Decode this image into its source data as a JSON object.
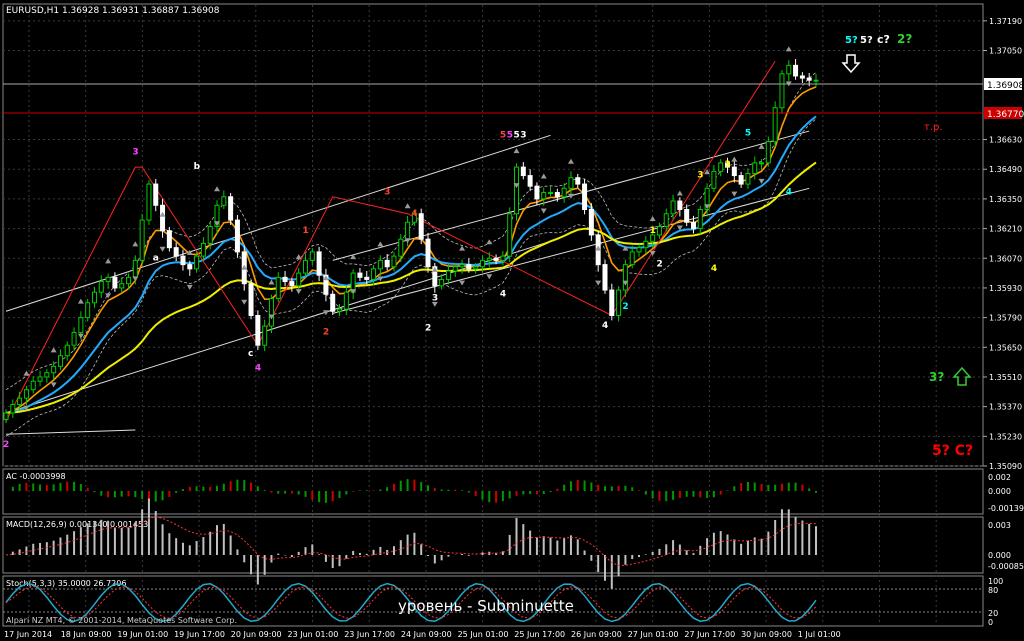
{
  "main_panel": {
    "header": "EURUSD,H1  1.36928 1.36931 1.36887 1.36908",
    "price_ticks": [
      "1.37190",
      "1.37050",
      "1.36630",
      "1.36490",
      "1.36350",
      "1.36210",
      "1.36070",
      "1.35930",
      "1.35790",
      "1.35650",
      "1.35510",
      "1.35370",
      "1.35230",
      "1.35090"
    ],
    "current_price_label": "1.36908",
    "tp_price_label": "1.36770",
    "tp_text": "т.р.",
    "chart_annotations": {
      "target_5": "5?",
      "target_5b": "5?",
      "target_c": "c?",
      "target_2": "2?",
      "lower_3": "3?",
      "bottom_5c": "5? C?"
    },
    "wave_labels": [
      {
        "text": "3",
        "color": "#ff44ff"
      },
      {
        "text": "b",
        "color": "#ffffff"
      },
      {
        "text": "a",
        "color": "#ffffff"
      },
      {
        "text": "c",
        "color": "#ffffff"
      },
      {
        "text": "4",
        "color": "#ff44ff"
      },
      {
        "text": "1",
        "color": "#ff4422"
      },
      {
        "text": "2",
        "color": "#ff4422"
      },
      {
        "text": "3",
        "color": "#ff4422"
      },
      {
        "text": "4",
        "color": "#ff4422"
      },
      {
        "text": "3",
        "color": "#ffffff"
      },
      {
        "text": "2",
        "color": "#ffffff"
      },
      {
        "text": "4",
        "color": "#ffffff"
      },
      {
        "text": "5",
        "color": "#ff4444"
      },
      {
        "text": "5",
        "color": "#ff44ff"
      },
      {
        "text": "5",
        "color": "#ffffff"
      },
      {
        "text": "3",
        "color": "#ffffff"
      },
      {
        "text": "4",
        "color": "#ffffff"
      },
      {
        "text": "2",
        "color": "#00ffff"
      },
      {
        "text": "1",
        "color": "#ffff00"
      },
      {
        "text": "2",
        "color": "#ffffff"
      },
      {
        "text": "3",
        "color": "#ffff00"
      },
      {
        "text": "4",
        "color": "#ffff00"
      },
      {
        "text": "3",
        "color": "#ffff00"
      },
      {
        "text": "5",
        "color": "#00ffff"
      },
      {
        "text": "4",
        "color": "#00ffff"
      },
      {
        "text": "2",
        "color": "#ff44ff"
      }
    ]
  },
  "ac_panel": {
    "header": "AC -0.0003998",
    "ticks": [
      "0.002",
      "0.000",
      "-0.001394"
    ]
  },
  "macd_panel": {
    "header": "MACD(12,26,9) 0.001340 0.001453",
    "ticks": [
      "0.003",
      "0.000",
      "-0.000854"
    ]
  },
  "stoch_panel": {
    "header": "Stoch(5,3,3) 35.0000 26.7206",
    "ticks": [
      "100",
      "80",
      "20",
      "0"
    ],
    "overlay_text": "уровень - Subminuette",
    "copyright": "Alpari NZ MT4, © 2001-2014, MetaQuotes Software Corp."
  },
  "time_axis": [
    "17 Jun 2014",
    "18 Jun 09:00",
    "19 Jun 01:00",
    "19 Jun 17:00",
    "20 Jun 09:00",
    "23 Jun 01:00",
    "23 Jun 17:00",
    "24 Jun 09:00",
    "25 Jun 01:00",
    "25 Jun 17:00",
    "26 Jun 09:00",
    "27 Jun 01:00",
    "27 Jun 17:00",
    "30 Jun 09:00",
    "1 Jul 01:00"
  ],
  "colors": {
    "background": "#000000",
    "bull_candle": "#00cc00",
    "bear_candle": "#ffffff",
    "grid": "#3a3a3a",
    "ma_fast": "#ff9900",
    "ma_mid": "#22aaff",
    "ma_slow": "#eeee00",
    "zigzag": "#ff2222",
    "tp_line": "#cc0000"
  },
  "chart_data": {
    "type": "candlestick",
    "symbol": "EURUSD",
    "timeframe": "H1",
    "ylim": [
      1.3509,
      1.3726
    ],
    "price_line": 1.36908,
    "tp_line": 1.3677,
    "close_series": [
      1.3534,
      1.3538,
      1.3541,
      1.3545,
      1.3549,
      1.3551,
      1.3553,
      1.3556,
      1.3561,
      1.3566,
      1.3572,
      1.3579,
      1.3586,
      1.3591,
      1.3596,
      1.3598,
      1.3593,
      1.3595,
      1.3598,
      1.3606,
      1.3625,
      1.3642,
      1.3632,
      1.362,
      1.3612,
      1.3608,
      1.3604,
      1.3602,
      1.3608,
      1.3614,
      1.3622,
      1.3632,
      1.3636,
      1.3625,
      1.361,
      1.3595,
      1.358,
      1.3566,
      1.3575,
      1.3588,
      1.3598,
      1.3596,
      1.3594,
      1.36,
      1.3606,
      1.361,
      1.3599,
      1.359,
      1.3582,
      1.3583,
      1.3591,
      1.36,
      1.3598,
      1.3597,
      1.3602,
      1.3606,
      1.3603,
      1.3608,
      1.3616,
      1.3624,
      1.3628,
      1.3616,
      1.3603,
      1.3594,
      1.3597,
      1.3601,
      1.3603,
      1.3604,
      1.3602,
      1.3603,
      1.3606,
      1.3607,
      1.3606,
      1.3608,
      1.3628,
      1.365,
      1.3646,
      1.3641,
      1.3635,
      1.3638,
      1.3638,
      1.3636,
      1.364,
      1.3645,
      1.3642,
      1.363,
      1.3618,
      1.3604,
      1.3592,
      1.358,
      1.3592,
      1.3604,
      1.361,
      1.3612,
      1.3615,
      1.3618,
      1.3622,
      1.3628,
      1.3634,
      1.363,
      1.3624,
      1.3621,
      1.363,
      1.364,
      1.3648,
      1.3652,
      1.365,
      1.3646,
      1.3642,
      1.3647,
      1.3652,
      1.3652,
      1.3662,
      1.3678,
      1.3694,
      1.3698,
      1.3693,
      1.3692,
      1.3691,
      1.3691
    ],
    "moving_averages": [
      {
        "name": "fast",
        "color": "#ff9900"
      },
      {
        "name": "mid",
        "color": "#22aaff"
      },
      {
        "name": "slow",
        "color": "#eeee00"
      }
    ],
    "indicators": [
      "AC",
      "MACD(12,26,9)",
      "Stoch(5,3,3)"
    ]
  }
}
